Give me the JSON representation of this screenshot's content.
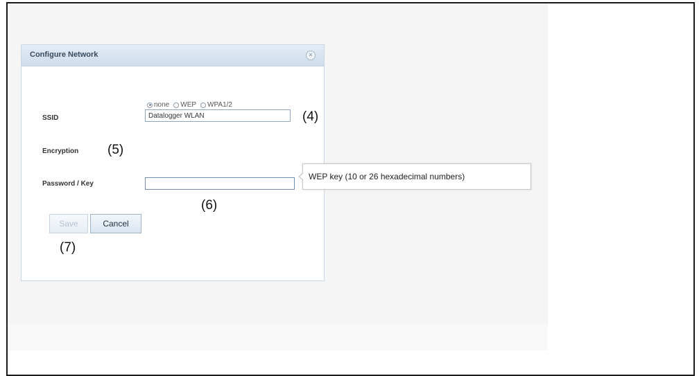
{
  "dialog": {
    "title": "Configure Network",
    "close_icon": "close-icon",
    "ssid_label": "SSID",
    "ssid_value": "Datalogger WLAN",
    "encryption_label": "Encryption",
    "encryption_options": [
      "none",
      "WEP",
      "WPA1/2"
    ],
    "encryption_selected": "none",
    "password_label": "Password / Key",
    "password_value": "",
    "save_label": "Save",
    "cancel_label": "Cancel"
  },
  "tooltip": {
    "text": "WEP key (10 or 26 hexadecimal numbers)"
  },
  "callouts": {
    "c4": "(4)",
    "c5": "(5)",
    "c6": "(6)",
    "c7": "(7)"
  }
}
